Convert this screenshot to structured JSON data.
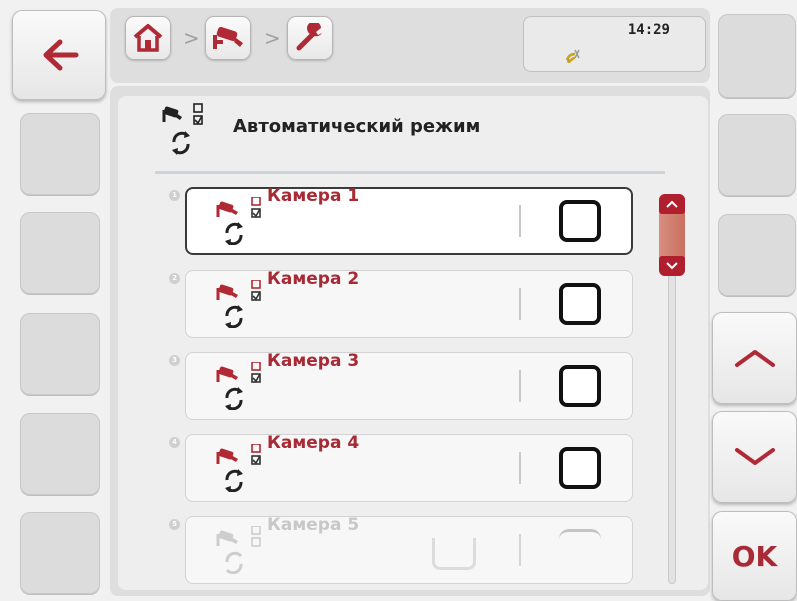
{
  "topbar": {
    "back_icon": "arrow-left-icon",
    "breadcrumb": [
      {
        "icon": "home-icon"
      },
      {
        "icon": "camera-icon"
      },
      {
        "icon": "wrench-icon"
      }
    ],
    "separator": ">",
    "time": "14:29",
    "status_icon": "signal-icon"
  },
  "header": {
    "title": "Автоматический режим",
    "icon": "camera-auto-mode-icon"
  },
  "list": {
    "items": [
      {
        "number": "1",
        "label": "Камера 1",
        "checked": false,
        "selected": true
      },
      {
        "number": "2",
        "label": "Камера 2",
        "checked": false,
        "selected": false
      },
      {
        "number": "3",
        "label": "Камера 3",
        "checked": false,
        "selected": false
      },
      {
        "number": "4",
        "label": "Камера 4",
        "checked": false,
        "selected": false
      },
      {
        "number": "5",
        "label": "Камера 5",
        "checked": false,
        "selected": false
      }
    ]
  },
  "softkeys": {
    "up_icon": "chevron-up-icon",
    "down_icon": "chevron-down-icon",
    "ok_label": "OK"
  },
  "colors": {
    "accent": "#a82a35",
    "scroll_thumb": "#d0806f"
  }
}
